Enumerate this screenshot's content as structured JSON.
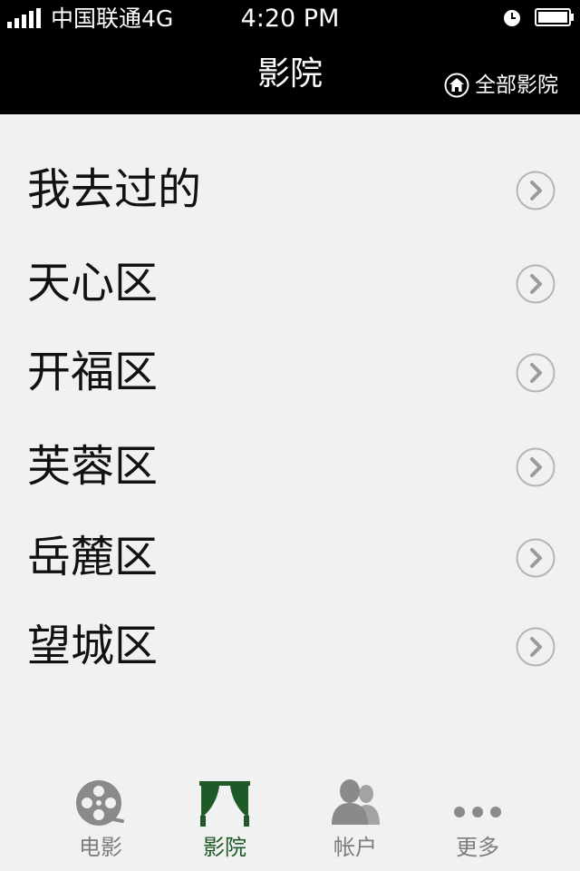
{
  "status_bar": {
    "carrier": "中国联通4G",
    "time": "4:20 PM"
  },
  "nav": {
    "title": "影院",
    "right_button_label": "全部影院",
    "right_button_icon": "home-icon"
  },
  "districts": [
    {
      "label": "我去过的"
    },
    {
      "label": "天心区"
    },
    {
      "label": "开福区"
    },
    {
      "label": "芙蓉区"
    },
    {
      "label": "岳麓区"
    },
    {
      "label": "望城区"
    }
  ],
  "tabbar": {
    "tabs": [
      {
        "label": "电影",
        "icon": "film-reel-icon",
        "active": false
      },
      {
        "label": "影院",
        "icon": "theater-curtain-icon",
        "active": true
      },
      {
        "label": "帐户",
        "icon": "account-people-icon",
        "active": false
      },
      {
        "label": "更多",
        "icon": "more-dots-icon",
        "active": false
      }
    ]
  },
  "colors": {
    "bar_background": "#000000",
    "page_background": "#f1f1f1",
    "active_tab": "#1d5a28",
    "inactive_tab": "#7d7d7d",
    "chevron": "#9a9a9a"
  }
}
